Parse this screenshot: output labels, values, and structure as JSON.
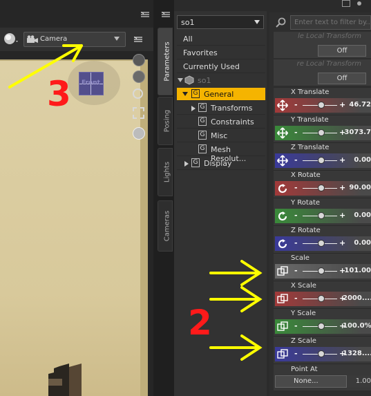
{
  "viewport": {
    "camera_label": "Camera",
    "cube_face_label": "Front"
  },
  "side_tabs": [
    "Parameters",
    "Posing",
    "Lights",
    "Cameras"
  ],
  "scene_tree": {
    "selected_node": "so1",
    "items": [
      "All",
      "Favorites",
      "Currently Used"
    ],
    "node": "so1",
    "groups": [
      "General",
      "Transforms",
      "Constraints",
      "Misc",
      "Mesh Resolut...",
      "Display"
    ]
  },
  "params": {
    "filter_placeholder": "Enter text to filter by...",
    "local_transform_1": "le Local Transform",
    "local_transform_2": "re Local Transform",
    "off_label": "Off",
    "rows": [
      {
        "name": "X Translate",
        "value": "46.72",
        "color": "#a23a3a"
      },
      {
        "name": "Y Translate",
        "value": "3073.7",
        "color": "#3a8a3a"
      },
      {
        "name": "Z Translate",
        "value": "0.00",
        "color": "#3a3a9a"
      },
      {
        "name": "X Rotate",
        "value": "90.00",
        "color": "#a23a3a"
      },
      {
        "name": "Y Rotate",
        "value": "0.00",
        "color": "#3a8a3a"
      },
      {
        "name": "Z Rotate",
        "value": "0.00",
        "color": "#3a3a9a"
      },
      {
        "name": "Scale",
        "value": "101.00",
        "color": "#6a6a6a"
      },
      {
        "name": "X Scale",
        "value": "2000....",
        "color": "#a23a3a"
      },
      {
        "name": "Y Scale",
        "value": "100.0%",
        "color": "#3a8a3a"
      },
      {
        "name": "Z Scale",
        "value": "1328....",
        "color": "#3a3a9a"
      }
    ],
    "point_at_label": "Point At",
    "point_at_button": "None...",
    "point_at_value": "1.00"
  },
  "annotations": [
    "3",
    "2"
  ],
  "accent_color": "#f5b400",
  "annotation_color": "#ff1a1a",
  "arrow_color": "#ffff00"
}
